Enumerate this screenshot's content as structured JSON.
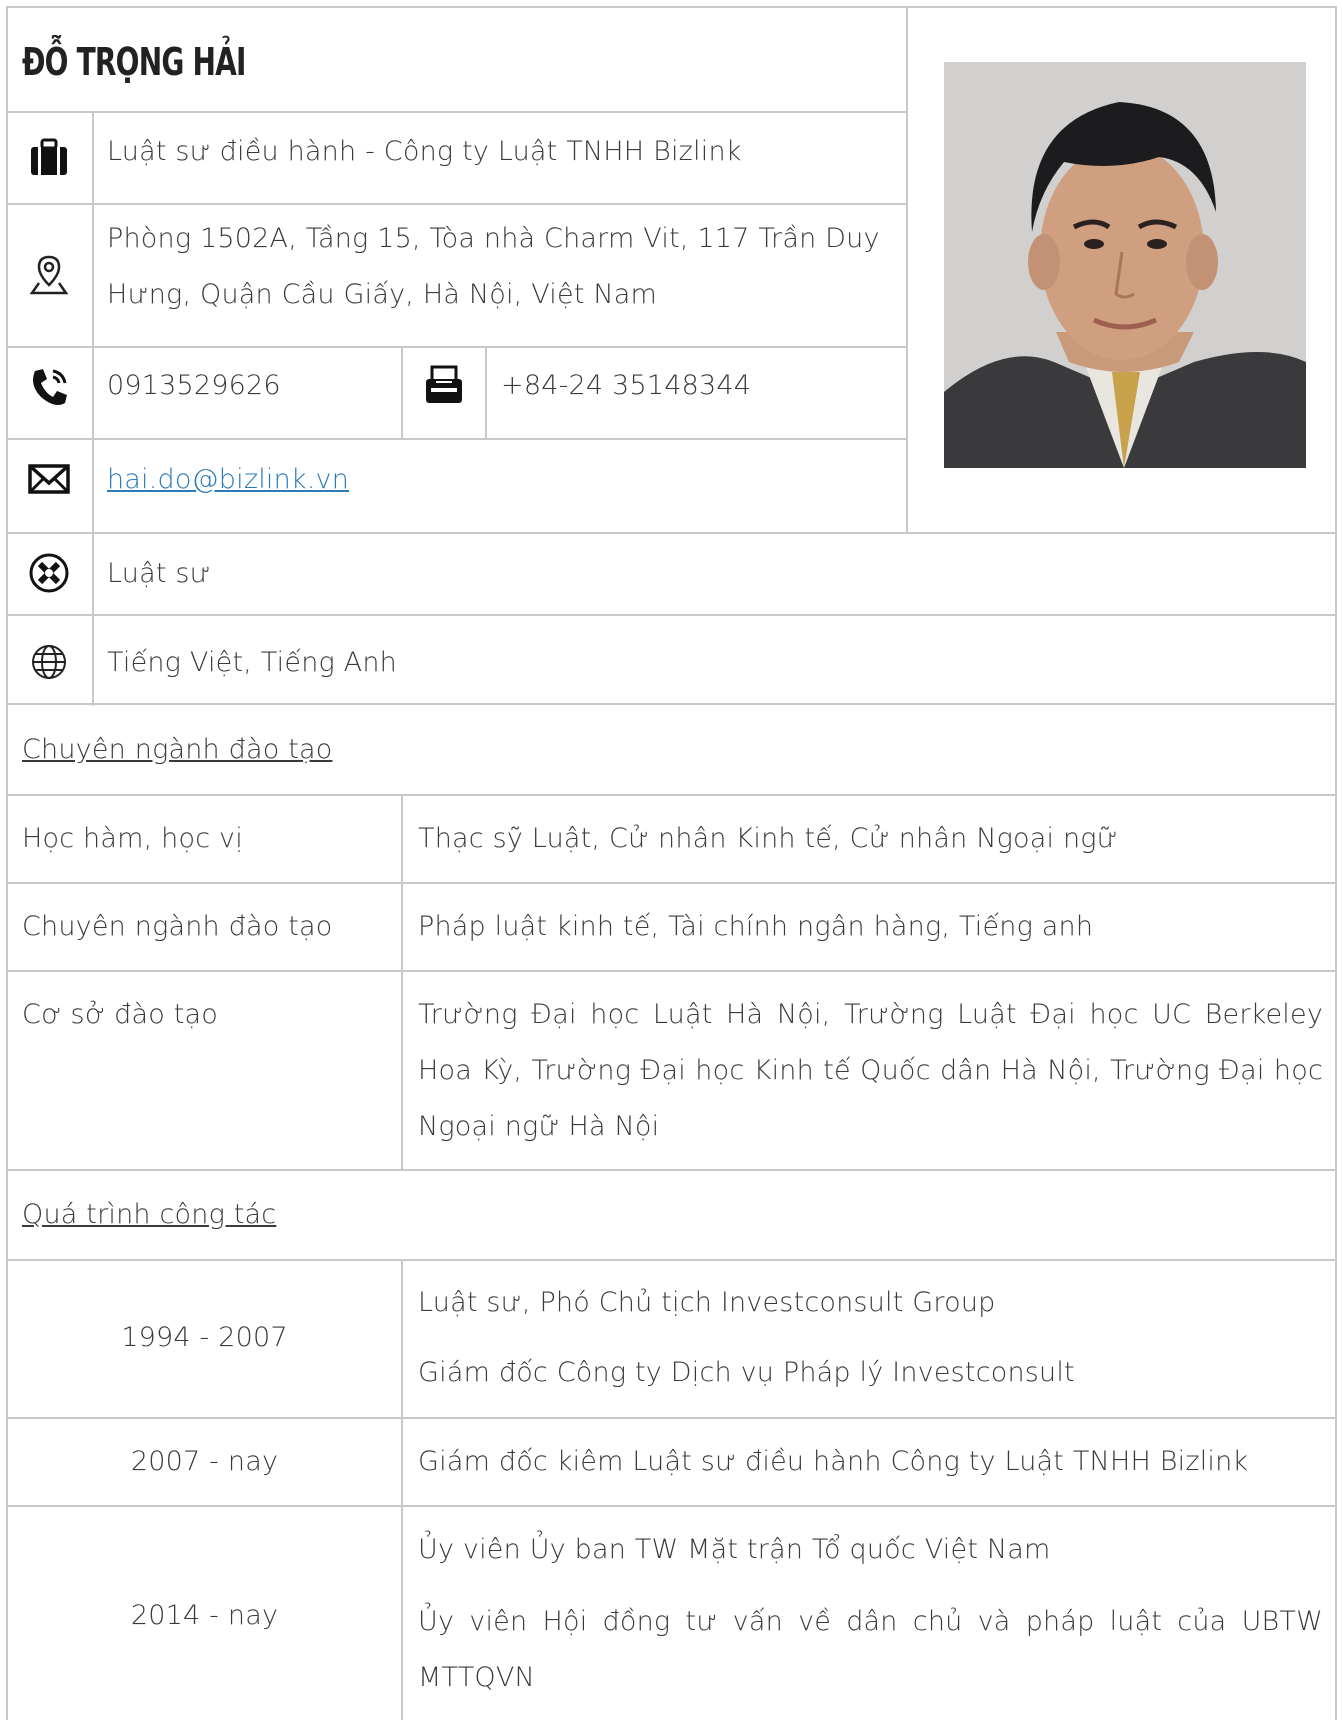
{
  "profile": {
    "name": "ĐỖ TRỌNG HẢI",
    "position": "Luật sư điều hành - Công ty Luật TNHH Bizlink",
    "address_line1": "Phòng 1502A, Tầng 15, Tòa nhà Charm Vit, 117 Trần Duy",
    "address_line2": "Hưng, Quận Cầu Giấy, Hà Nội, Việt Nam",
    "phone": "0913529626",
    "fax": "+84-24 35148344",
    "email": "hai.do@bizlink.vn",
    "title": "Luật sư",
    "languages": "Tiếng Việt, Tiếng Anh"
  },
  "icons": {
    "position": "briefcase-icon",
    "address": "map-pin-icon",
    "phone": "phone-icon",
    "fax": "fax-icon",
    "email": "envelope-icon",
    "title": "law-badge-icon",
    "languages": "globe-icon"
  },
  "education": {
    "heading": "Chuyên ngành đào tạo",
    "rows": [
      {
        "label": "Học hàm, học vị",
        "value": "Thạc sỹ Luật, Cử nhân Kinh tế, Cử nhân Ngoại ngữ"
      },
      {
        "label": "Chuyên ngành đào tạo",
        "value": "Pháp luật kinh tế, Tài chính ngân hàng, Tiếng anh"
      },
      {
        "label": "Cơ sở đào tạo",
        "value": "Trường Đại học Luật Hà Nội, Trường Luật Đại học UC Berkeley Hoa Kỳ, Trường Đại học Kinh tế Quốc dân Hà Nội, Trường Đại học Ngoại ngữ Hà Nội"
      }
    ]
  },
  "career": {
    "heading": "Quá trình công tác",
    "rows": [
      {
        "period": "1994 - 2007",
        "items": [
          "Luật sư, Phó Chủ tịch Investconsult Group",
          "Giám đốc Công ty Dịch vụ Pháp lý Investconsult"
        ]
      },
      {
        "period": "2007 - nay",
        "items": [
          "Giám đốc kiêm Luật sư điều hành Công ty Luật TNHH Bizlink"
        ]
      },
      {
        "period": "2014 - nay",
        "items": [
          "Ủy viên Ủy ban TW Mặt trận Tổ quốc Việt Nam",
          "Ủy viên Hội đồng tư vấn về dân chủ và pháp luật của UBTW MTTQVN"
        ]
      }
    ]
  },
  "colors": {
    "border": "#c8c8c8",
    "link": "#2a7ab8",
    "text": "#3a3a3a"
  }
}
